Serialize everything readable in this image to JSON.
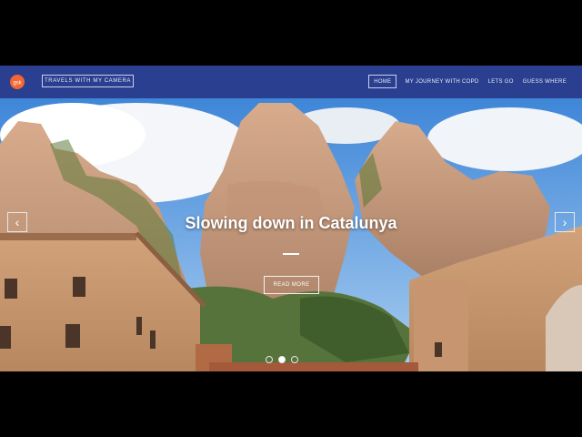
{
  "brand": {
    "label": "TRAVELS WITH MY CAMERA",
    "logo_text": "gsk"
  },
  "nav": {
    "items": [
      {
        "label": "HOME",
        "active": true
      },
      {
        "label": "MY JOURNEY WITH COPD",
        "active": false
      },
      {
        "label": "LETS GO",
        "active": false
      },
      {
        "label": "GUESS WHERE",
        "active": false
      }
    ]
  },
  "hero": {
    "title": "Slowing down in Catalunya",
    "read_more_label": "READ MORE",
    "prev_icon": "chevron-left-icon",
    "next_icon": "chevron-right-icon",
    "slides": [
      {
        "active": false
      },
      {
        "active": true
      },
      {
        "active": false
      }
    ]
  },
  "colors": {
    "navbar": "#2a3f8f",
    "logo_orange": "#f36633",
    "sky": "#4a8fd6",
    "rock": "#c89a7c"
  }
}
